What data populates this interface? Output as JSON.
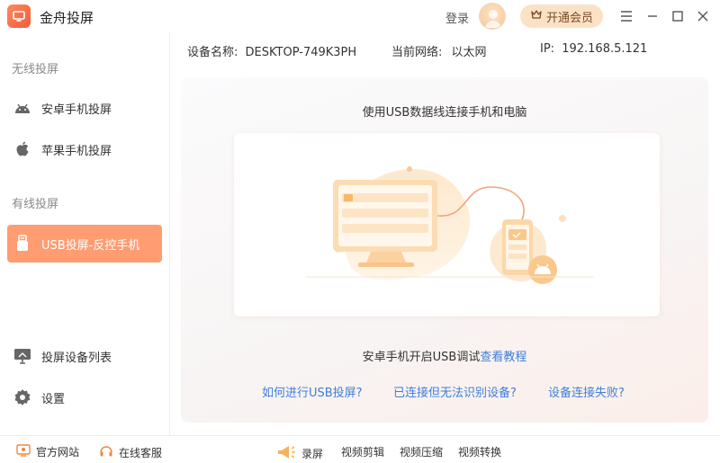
{
  "app": {
    "title": "金舟投屏"
  },
  "header": {
    "login": "登录",
    "vip": "开通会员"
  },
  "sidebar": {
    "wireless_label": "无线投屏",
    "wired_label": "有线投屏",
    "items": [
      {
        "label": "安卓手机投屏"
      },
      {
        "label": "苹果手机投屏"
      },
      {
        "label": "USB投屏-反控手机"
      },
      {
        "label": "投屏设备列表"
      },
      {
        "label": "设置"
      }
    ]
  },
  "device": {
    "name_label": "设备名称:",
    "name_value": "DESKTOP-749K3PH",
    "network_label": "当前网络:",
    "network_value": "以太网",
    "ip_label": "IP:",
    "ip_value": "192.168.5.121"
  },
  "main": {
    "title": "使用USB数据线连接手机和电脑",
    "tip_prefix": "安卓手机开启USB调试",
    "tip_link": "查看教程",
    "faq": [
      "如何进行USB投屏?",
      "已连接但无法识别设备?",
      "设备连接失败?"
    ]
  },
  "footer": {
    "website": "官方网站",
    "support": "在线客服",
    "tools": [
      "录屏",
      "视频剪辑",
      "视频压缩",
      "视频转换"
    ]
  },
  "colors": {
    "accent": "#ff9c72",
    "link": "#3f7fd9",
    "vip_bg": "#fbe2c7"
  },
  "icons": [
    "app-logo-icon",
    "crown-icon",
    "menu-icon",
    "minimize-icon",
    "maximize-icon",
    "close-icon",
    "android-icon",
    "apple-icon",
    "usb-icon",
    "monitor-icon",
    "gear-icon",
    "website-icon",
    "headset-icon",
    "megaphone-icon"
  ]
}
